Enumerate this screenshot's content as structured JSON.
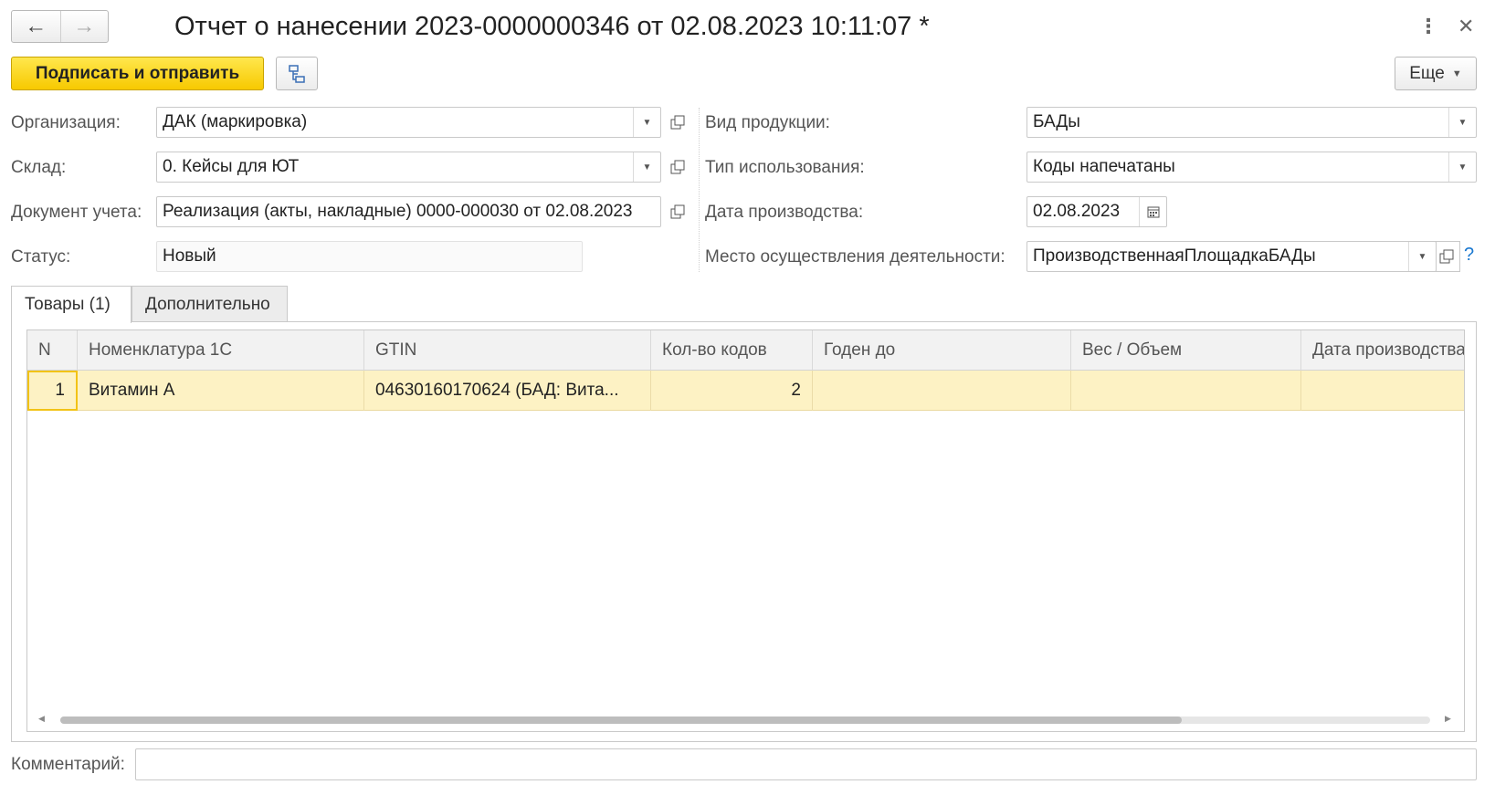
{
  "header": {
    "back_icon": "arrow-left-icon",
    "forward_icon": "arrow-right-icon",
    "title": "Отчет о нанесении 2023-0000000346 от 02.08.2023 10:11:07 *",
    "more_icon": "vertical-dots-icon",
    "close_icon": "close-icon"
  },
  "toolbar": {
    "sign_send_label": "Подписать и отправить",
    "structure_icon": "document-structure-icon",
    "more_label": "Еще"
  },
  "form": {
    "organization": {
      "label": "Организация:",
      "value": "ДАК (маркировка)"
    },
    "warehouse": {
      "label": "Склад:",
      "value": "0. Кейсы для ЮТ"
    },
    "accounting_doc": {
      "label": "Документ учета:",
      "value": "Реализация (акты, накладные) 0000-000030 от 02.08.2023"
    },
    "status": {
      "label": "Статус:",
      "value": "Новый"
    },
    "product_kind": {
      "label": "Вид продукции:",
      "value": "БАДы"
    },
    "usage_type": {
      "label": "Тип использования:",
      "value": "Коды напечатаны"
    },
    "production_date": {
      "label": "Дата производства:",
      "value": "02.08.2023"
    },
    "activity_place": {
      "label": "Место осуществления деятельности:",
      "value": "ПроизводственнаяПлощадкаБАДы"
    },
    "help": "?"
  },
  "tabs": [
    {
      "label": "Товары (1)",
      "active": true
    },
    {
      "label": "Дополнительно",
      "active": false
    }
  ],
  "table": {
    "columns": [
      "N",
      "Номенклатура 1С",
      "GTIN",
      "Кол-во кодов",
      "Годен до",
      "Вес / Объем",
      "Дата производства"
    ],
    "rows": [
      [
        "1",
        "Витамин А",
        "04630160170624 (БАД: Вита...",
        "2",
        "",
        "",
        ""
      ]
    ]
  },
  "comment": {
    "label": "Комментарий:",
    "value": ""
  },
  "colors": {
    "primary_button": "#f7c900",
    "selected_row": "#fdf2c4",
    "help": "#1a78d0"
  }
}
